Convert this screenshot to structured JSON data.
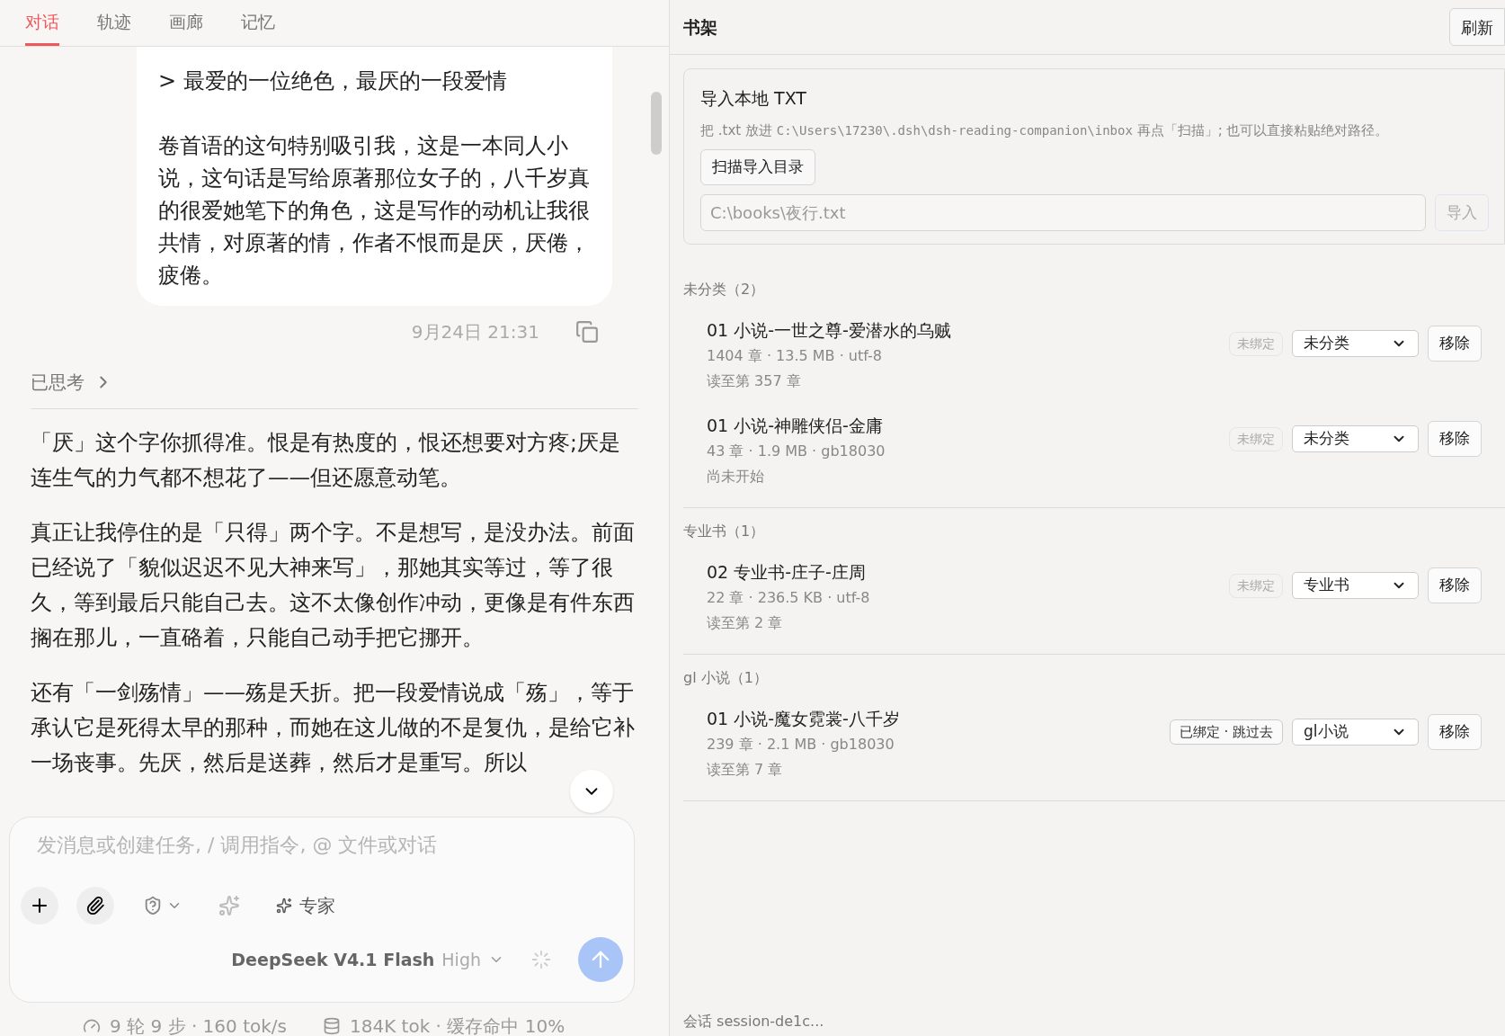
{
  "tabs": [
    {
      "label": "对话",
      "selected": true
    },
    {
      "label": "轨迹",
      "selected": false
    },
    {
      "label": "画廊",
      "selected": false
    },
    {
      "label": "记忆",
      "selected": false
    }
  ],
  "chat": {
    "user_message": [
      "> 最爱的一位绝色，最厌的一段爱情",
      "卷首语的这句特别吸引我，这是一本同人小说，这句话是写给原著那位女子的，八千岁真的很爱她笔下的角色，这是写作的动机让我很共情，对原著的情，作者不恨而是厌，厌倦，疲倦。"
    ],
    "timestamp": "9月24日 21:31",
    "thinking": {
      "label": "已思考",
      "expanded": false
    },
    "reply": [
      "「厌」这个字你抓得准。恨是有热度的，恨还想要对方疼;厌是连生气的力气都不想花了——但还愿意动笔。",
      "真正让我停住的是「只得」两个字。不是想写，是没办法。前面已经说了「貌似迟迟不见大神来写」，那她其实等过，等了很久，等到最后只能自己去。这不太像创作冲动，更像是有件东西搁在那儿，一直硌着，只能自己动手把它挪开。",
      "还有「一剑殇情」——殇是夭折。把一段爱情说成「殇」，等于承认它是死得太早的那种，而她在这儿做的不是复仇，是给它补一场丧事。先厌，然后是送葬，然后才是重写。所以"
    ]
  },
  "composer": {
    "placeholder": "发消息或创建任务, / 调用指令, @ 文件或对话",
    "mode": "专家",
    "model": "DeepSeek V4.1 Flash",
    "effort": "High"
  },
  "stats": {
    "speed": "9 轮 9 步 · 160 tok/s",
    "tokens": "184K tok · 缓存命中 10%"
  },
  "shelf": {
    "title": "书架",
    "refresh": "刷新",
    "import": {
      "title": "导入本地 TXT",
      "hint_before": "把 .txt 放进",
      "path": "C:\\Users\\17230\\.dsh\\dsh-reading-companion\\inbox",
      "hint_after": "再点「扫描」; 也可以直接粘贴绝对路径。",
      "scan_button": "扫描导入目录",
      "placeholder": "C:\\books\\夜行.txt",
      "import_button": "导入"
    },
    "groups": [
      {
        "label": "未分类（2）",
        "books": [
          {
            "title": "01 小说-一世之尊-爱潜水的乌贼",
            "meta": "1404 章 · 13.5 MB · utf-8",
            "progress": "读至第 357 章",
            "binding": "未绑定",
            "bound": false,
            "category": "未分类",
            "remove": "移除"
          },
          {
            "title": "01 小说-神雕侠侣-金庸",
            "meta": "43 章 · 1.9 MB · gb18030",
            "progress": "尚未开始",
            "binding": "未绑定",
            "bound": false,
            "category": "未分类",
            "remove": "移除"
          }
        ]
      },
      {
        "label": "专业书（1）",
        "books": [
          {
            "title": "02 专业书-庄子-庄周",
            "meta": "22 章 · 236.5 KB · utf-8",
            "progress": "读至第 2 章",
            "binding": "未绑定",
            "bound": false,
            "category": "专业书",
            "remove": "移除"
          }
        ]
      },
      {
        "label": "gl 小说（1）",
        "books": [
          {
            "title": "01 小说-魔女霓裳-八千岁",
            "meta": "239 章 · 2.1 MB · gb18030",
            "progress": "读至第 7 章",
            "binding": "已绑定 · 跳过去",
            "bound": true,
            "category": "gl小说",
            "remove": "移除"
          }
        ]
      }
    ],
    "session": "会话 session-de1c..."
  }
}
